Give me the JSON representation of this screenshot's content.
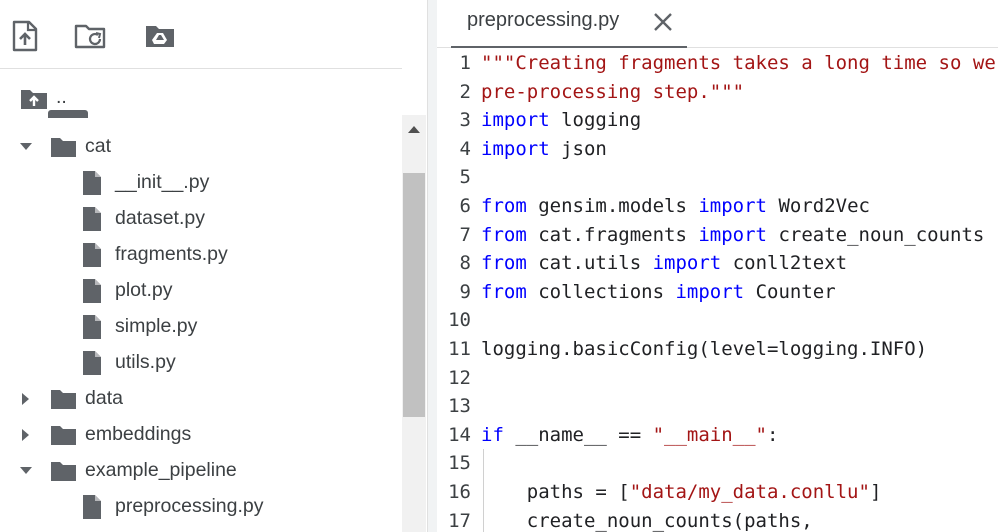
{
  "file_browser": {
    "toolbar": [
      {
        "name": "upload-file-icon"
      },
      {
        "name": "refresh-icon"
      },
      {
        "name": "mount-drive-icon"
      }
    ],
    "parent_label": "..",
    "tree": [
      {
        "label": "cat",
        "type": "folder",
        "expanded": true,
        "depth": 0
      },
      {
        "label": "__init__.py",
        "type": "file",
        "depth": 1
      },
      {
        "label": "dataset.py",
        "type": "file",
        "depth": 1
      },
      {
        "label": "fragments.py",
        "type": "file",
        "depth": 1
      },
      {
        "label": "plot.py",
        "type": "file",
        "depth": 1
      },
      {
        "label": "simple.py",
        "type": "file",
        "depth": 1
      },
      {
        "label": "utils.py",
        "type": "file",
        "depth": 1
      },
      {
        "label": "data",
        "type": "folder",
        "expanded": false,
        "depth": 0
      },
      {
        "label": "embeddings",
        "type": "folder",
        "expanded": false,
        "depth": 0
      },
      {
        "label": "example_pipeline",
        "type": "folder",
        "expanded": true,
        "depth": 0
      },
      {
        "label": "preprocessing.py",
        "type": "file",
        "depth": 1
      }
    ]
  },
  "editor": {
    "tab_title": "preprocessing.py",
    "lines": [
      {
        "n": "1",
        "tokens": [
          [
            "str",
            "\"\"\"Creating fragments takes a long time so we"
          ]
        ]
      },
      {
        "n": "2",
        "tokens": [
          [
            "str",
            "pre-processing step.\"\"\""
          ]
        ]
      },
      {
        "n": "3",
        "tokens": [
          [
            "kw",
            "import"
          ],
          [
            "",
            " logging"
          ]
        ]
      },
      {
        "n": "4",
        "tokens": [
          [
            "kw",
            "import"
          ],
          [
            "",
            " json"
          ]
        ]
      },
      {
        "n": "5",
        "tokens": []
      },
      {
        "n": "6",
        "tokens": [
          [
            "kw",
            "from"
          ],
          [
            "",
            " gensim.models "
          ],
          [
            "kw",
            "import"
          ],
          [
            "",
            " Word2Vec"
          ]
        ]
      },
      {
        "n": "7",
        "tokens": [
          [
            "kw",
            "from"
          ],
          [
            "",
            " cat.fragments "
          ],
          [
            "kw",
            "import"
          ],
          [
            "",
            " create_noun_counts"
          ]
        ]
      },
      {
        "n": "8",
        "tokens": [
          [
            "kw",
            "from"
          ],
          [
            "",
            " cat.utils "
          ],
          [
            "kw",
            "import"
          ],
          [
            "",
            " conll2text"
          ]
        ]
      },
      {
        "n": "9",
        "tokens": [
          [
            "kw",
            "from"
          ],
          [
            "",
            " collections "
          ],
          [
            "kw",
            "import"
          ],
          [
            "",
            " Counter"
          ]
        ]
      },
      {
        "n": "10",
        "tokens": []
      },
      {
        "n": "11",
        "tokens": [
          [
            "",
            "logging.basicConfig(level=logging.INFO)"
          ]
        ]
      },
      {
        "n": "12",
        "tokens": []
      },
      {
        "n": "13",
        "tokens": []
      },
      {
        "n": "14",
        "tokens": [
          [
            "kw",
            "if"
          ],
          [
            "",
            " __name__ == "
          ],
          [
            "str",
            "\"__main__\""
          ],
          [
            "",
            ":"
          ]
        ]
      },
      {
        "n": "15",
        "tokens": []
      },
      {
        "n": "16",
        "tokens": [
          [
            "",
            "    paths = ["
          ],
          [
            "str",
            "\"data/my_data.conllu\""
          ],
          [
            "",
            "]"
          ]
        ]
      },
      {
        "n": "17",
        "tokens": [
          [
            "",
            "    create_noun_counts(paths,"
          ]
        ]
      }
    ]
  },
  "colors": {
    "keyword": "#0000ff",
    "string": "#a31515",
    "icon": "#5f6368"
  }
}
